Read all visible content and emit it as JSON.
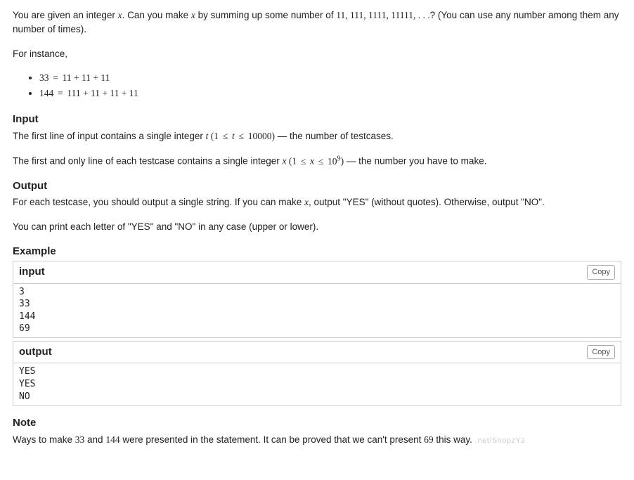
{
  "intro": {
    "p1_prefix": "You are given an integer ",
    "p1_var": "x",
    "p1_mid": ". Can you make ",
    "p1_var2": "x",
    "p1_after": " by summing up some number of ",
    "p1_sequence": "11, 111, 1111, 11111, . . .",
    "p1_tail": "? (You can use any number among them any number of times).",
    "p2": "For instance,"
  },
  "examples_list": {
    "e1_lhs": "33",
    "e1_eq": "=",
    "e1_rhs": "11 + 11 + 11",
    "e2_lhs": "144",
    "e2_eq": "=",
    "e2_rhs": "111 + 11 + 11 + 11"
  },
  "input": {
    "title": "Input",
    "p1_prefix": "The first line of input contains a single integer ",
    "p1_var": "t",
    "p1_open": " (",
    "p1_low": "1",
    "p1_le1": "≤",
    "p1_mid": "t",
    "p1_le2": "≤",
    "p1_high": "10000",
    "p1_close": ")",
    "p1_dash": " — ",
    "p1_tail": "the number of testcases.",
    "p2_prefix": "The first and only line of each testcase contains a single integer ",
    "p2_var": "x",
    "p2_open": " (",
    "p2_low": "1",
    "p2_le1": "≤",
    "p2_mid": "x",
    "p2_le2": "≤",
    "p2_highbase": "10",
    "p2_highexp": "9",
    "p2_close": ")",
    "p2_dash": " — ",
    "p2_tail": "the number you have to make."
  },
  "output": {
    "title": "Output",
    "p1_prefix": "For each testcase, you should output a single string. If you can make ",
    "p1_var": "x",
    "p1_tail": ", output \"YES\" (without quotes). Otherwise, output \"NO\".",
    "p2": "You can print each letter of \"YES\" and \"NO\" in any case (upper or lower)."
  },
  "example": {
    "title": "Example",
    "input_label": "input",
    "output_label": "output",
    "copy_label": "Copy",
    "input_text": "3\n33\n144\n69",
    "output_text": "YES\nYES\nNO"
  },
  "note": {
    "title": "Note",
    "prefix": "Ways to make ",
    "n1": "33",
    "mid": " and ",
    "n2": "144",
    "mid2": " were presented in the statement. It can be proved that we can't present ",
    "n3": "69",
    "tail": " this way.",
    "watermark": ".net/SnopzYz"
  }
}
